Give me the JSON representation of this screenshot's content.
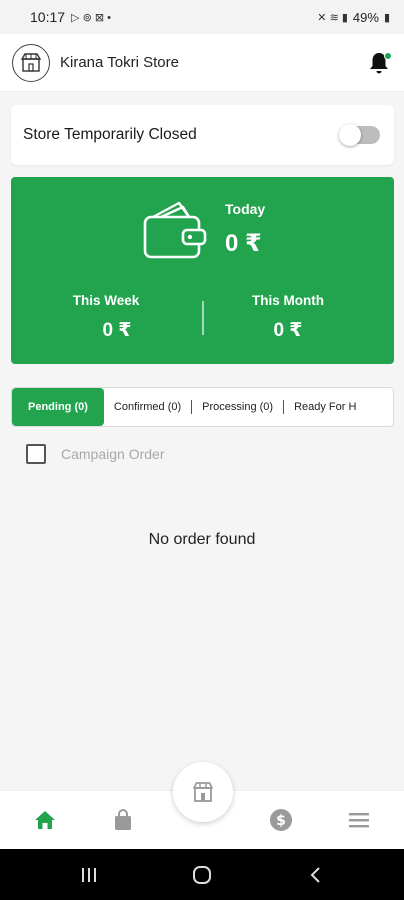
{
  "status_bar": {
    "time": "10:17",
    "battery": "49%"
  },
  "header": {
    "store_name": "Kirana Tokri Store",
    "logo_icon": "kirana-tokri-logo",
    "notification_icon": "bell-icon"
  },
  "store_status": {
    "label": "Store Temporarily Closed",
    "toggle_on": false
  },
  "earnings": {
    "today_label": "Today",
    "today_value": "0 ₹",
    "week_label": "This Week",
    "week_value": "0 ₹",
    "month_label": "This Month",
    "month_value": "0 ₹",
    "wallet_icon": "wallet-icon"
  },
  "tabs": [
    {
      "label": "Pending (0)",
      "active": true
    },
    {
      "label": "Confirmed (0)",
      "active": false
    },
    {
      "label": "Processing (0)",
      "active": false
    },
    {
      "label": "Ready For H",
      "active": false
    }
  ],
  "filter": {
    "campaign_label": "Campaign Order",
    "checked": false
  },
  "empty_state": "No order found",
  "bottom_nav": {
    "items": [
      "home-icon",
      "bag-icon",
      "store-icon",
      "dollar-icon",
      "menu-icon"
    ],
    "active": "home-icon"
  },
  "colors": {
    "primary": "#22a44f",
    "notification_dot": "#1fa34a",
    "inactive_icon": "#9a9a9a"
  }
}
